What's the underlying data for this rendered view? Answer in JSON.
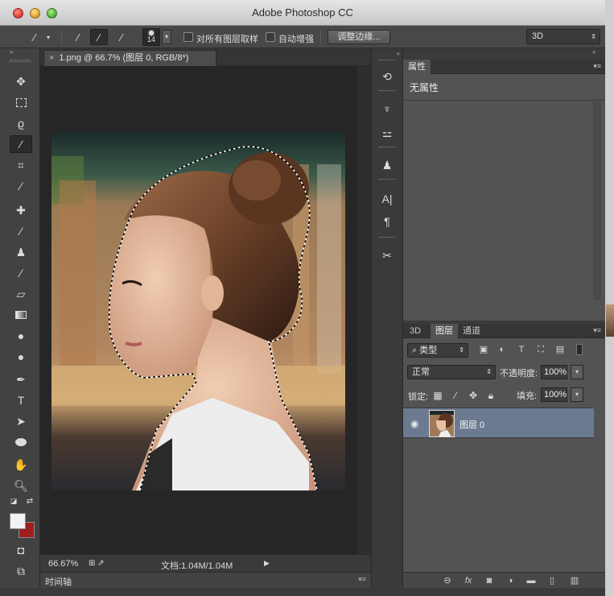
{
  "app": {
    "title": "Adobe Photoshop CC"
  },
  "options_bar": {
    "brush_size": "14",
    "sample_all_layers_label": "对所有图层取样",
    "auto_enhance_label": "自动增强",
    "refine_edge_button": "调整边缘...",
    "workspace_selected": "3D"
  },
  "toolbox": {
    "tools": [
      "move-tool-icon",
      "rectangular-marquee-icon",
      "lasso-icon",
      "quick-selection-icon",
      "crop-icon",
      "eyedropper-icon",
      "spot-healing-icon",
      "brush-icon",
      "clone-stamp-icon",
      "history-brush-icon",
      "eraser-icon",
      "gradient-icon",
      "blur-icon",
      "dodge-icon",
      "pen-icon",
      "type-icon",
      "path-selection-icon",
      "ellipse-icon",
      "hand-icon",
      "zoom-icon"
    ],
    "active_tool": "quick-selection-icon",
    "foreground_color": "#f2f2f2",
    "background_color": "#a01e1e"
  },
  "document": {
    "tab_title": "1.png @ 66.7% (图层 0, RGB/8*)",
    "zoom": "66.67%",
    "doc_size": "文档:1.04M/1.04M"
  },
  "timeline": {
    "label": "时间轴"
  },
  "properties": {
    "tab_label": "属性",
    "body_text": "无属性"
  },
  "layers_panel": {
    "tabs": [
      "3D",
      "图层",
      "通道"
    ],
    "active_tab": "图层",
    "filter_kind": "类型",
    "blend_mode": "正常",
    "opacity_label": "不透明度:",
    "opacity_value": "100%",
    "lock_label": "锁定:",
    "fill_label": "填充:",
    "fill_value": "100%",
    "layers": [
      {
        "name": "图层 0",
        "visible": true,
        "selected": true
      }
    ]
  },
  "colors": {
    "panel_bg": "#535353",
    "selected_layer": "#6b7a90",
    "canvas_bg": "#262626"
  }
}
